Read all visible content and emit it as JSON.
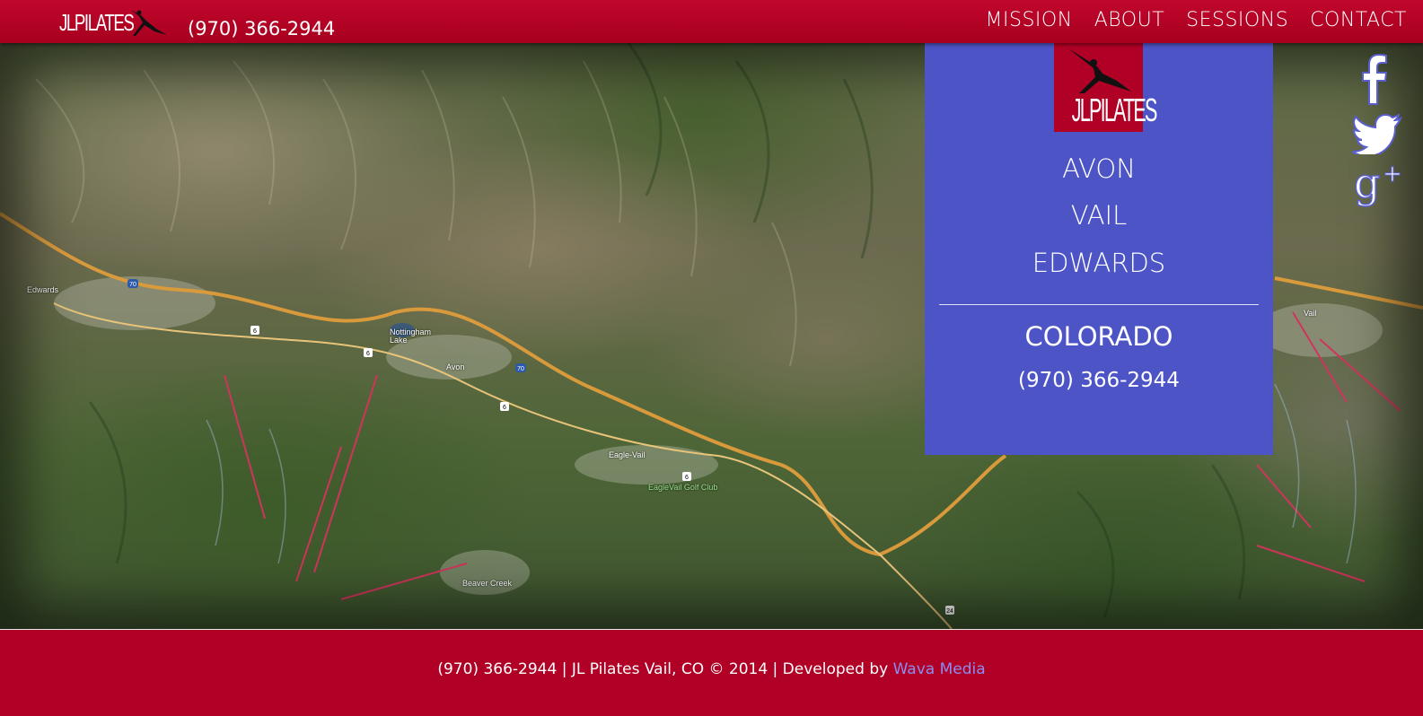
{
  "header": {
    "logo_text": "JLPILATES",
    "phone": "(970) 366-2944",
    "nav": [
      {
        "label": "MISSION"
      },
      {
        "label": "ABOUT"
      },
      {
        "label": "SESSIONS"
      },
      {
        "label": "CONTACT"
      }
    ]
  },
  "map": {
    "labels": [
      "Edwards",
      "Nottingham Lake",
      "Avon",
      "Eagle-Vail",
      "EagleVail Golf Club",
      "Beaver Creek",
      "Vail"
    ],
    "route_shields": [
      "70",
      "6",
      "6",
      "70",
      "6",
      "6",
      "24"
    ]
  },
  "panel": {
    "logo_text": "JLPILATES",
    "cities": [
      "AVON",
      "VAIL",
      "EDWARDS"
    ],
    "state": "COLORADO",
    "phone": "(970) 366-2944",
    "bg_color": "#4d55c6"
  },
  "social": {
    "icons": [
      "facebook-icon",
      "twitter-icon",
      "google-plus-icon"
    ]
  },
  "footer": {
    "text": "(970) 366-2944 | JL Pilates Vail, CO © 2014 | Developed by ",
    "link_text": "Wava Media"
  },
  "colors": {
    "brand_red": "#b00025",
    "panel_blue": "#4d55c6",
    "link_purple": "#8b8cf0"
  }
}
